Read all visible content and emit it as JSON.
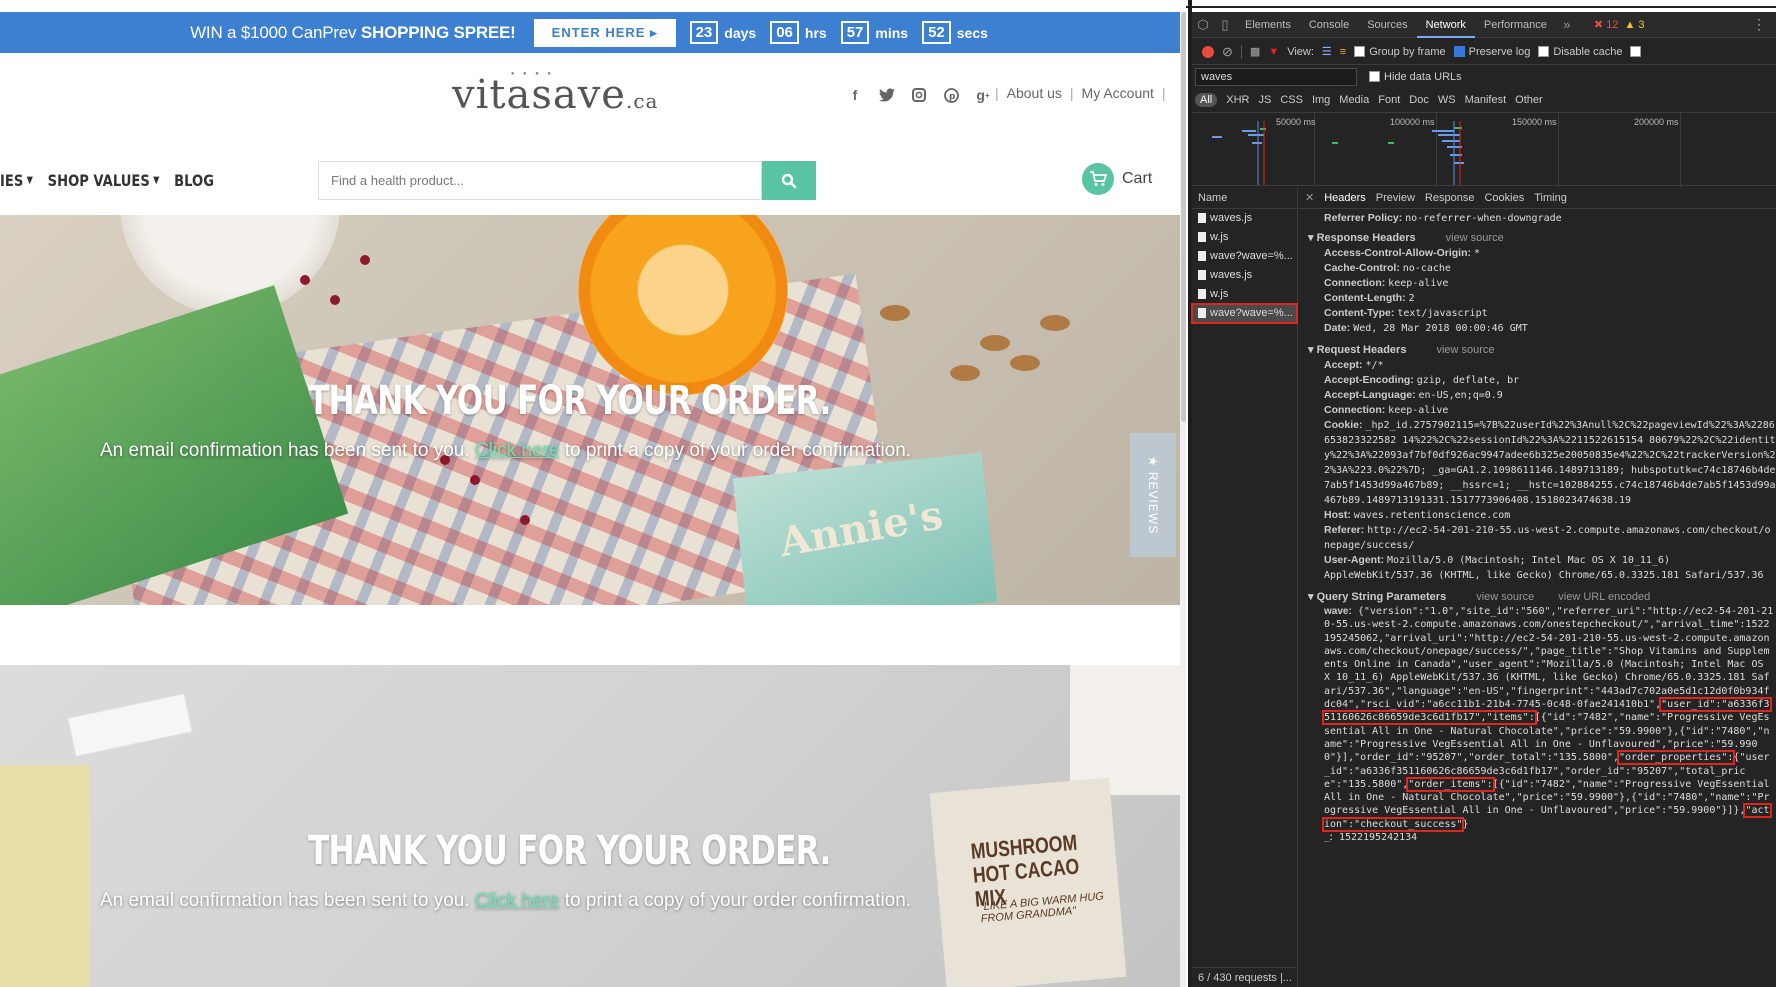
{
  "promo": {
    "text_win": "WIN a $1000 CanPrev ",
    "text_spree": "SHOPPING SPREE!",
    "button": "ENTER HERE",
    "days": "23",
    "days_label": "days",
    "hrs": "06",
    "hrs_label": "hrs",
    "mins": "57",
    "mins_label": "mins",
    "secs": "52",
    "secs_label": "secs",
    "bg_color": "#3d7fd0"
  },
  "header": {
    "logo_main": "vitasave",
    "logo_tld": ".ca",
    "about": "About us",
    "account": "My Account",
    "social_icons": [
      "facebook-icon",
      "twitter-icon",
      "instagram-icon",
      "pinterest-icon",
      "google-plus-icon"
    ]
  },
  "nav": {
    "items": [
      {
        "label": "IES"
      },
      {
        "label": "SHOP VALUES"
      },
      {
        "label": "BLOG"
      }
    ]
  },
  "search": {
    "placeholder": "Find a health product..."
  },
  "cart": {
    "label": "Cart"
  },
  "hero": {
    "thanks": "THANK YOU FOR YOUR ORDER.",
    "email_pre": "An email confirmation has been sent to you. ",
    "link": "Click here",
    "email_post": " to print a copy of your order confirmation.",
    "box_brand": "Annie's",
    "cocoa_name": "MUSHROOM HOT CACAO MIX",
    "cocoa_quote": "\"LIKE A BIG WARM HUG FROM GRANDMA\""
  },
  "reviews_tab": "★ REVIEWS",
  "devtools": {
    "tabs": [
      "Elements",
      "Console",
      "Sources",
      "Network",
      "Performance"
    ],
    "active_tab": "Network",
    "errors": "12",
    "warnings": "3",
    "view_label": "View:",
    "group_by_frame": "Group by frame",
    "preserve_log": "Preserve log",
    "disable_cache": "Disable cache",
    "filter_value": "waves",
    "hide_data_urls": "Hide data URLs",
    "types": [
      "All",
      "XHR",
      "JS",
      "CSS",
      "Img",
      "Media",
      "Font",
      "Doc",
      "WS",
      "Manifest",
      "Other"
    ],
    "timeline_labels": [
      "50000 ms",
      "100000 ms",
      "150000 ms",
      "200000 ms"
    ],
    "name_header": "Name",
    "requests": [
      "waves.js",
      "w.js",
      "wave?wave=%...",
      "waves.js",
      "w.js",
      "wave?wave=%..."
    ],
    "requests_footer": "6 / 430 requests  |...",
    "detail_tabs": [
      "Headers",
      "Preview",
      "Response",
      "Cookies",
      "Timing"
    ],
    "referrer_policy_key": "Referrer Policy:",
    "referrer_policy_val": "no-referrer-when-downgrade",
    "response_headers_title": "Response Headers",
    "view_source": "view source",
    "view_url_encoded": "view URL encoded",
    "response_headers": [
      {
        "k": "Access-Control-Allow-Origin:",
        "v": "*"
      },
      {
        "k": "Cache-Control:",
        "v": "no-cache"
      },
      {
        "k": "Connection:",
        "v": "keep-alive"
      },
      {
        "k": "Content-Length:",
        "v": "2"
      },
      {
        "k": "Content-Type:",
        "v": "text/javascript"
      },
      {
        "k": "Date:",
        "v": "Wed, 28 Mar 2018 00:00:46 GMT"
      }
    ],
    "request_headers_title": "Request Headers",
    "request_headers": [
      {
        "k": "Accept:",
        "v": "*/*"
      },
      {
        "k": "Accept-Encoding:",
        "v": "gzip, deflate, br"
      },
      {
        "k": "Accept-Language:",
        "v": "en-US,en;q=0.9"
      },
      {
        "k": "Connection:",
        "v": "keep-alive"
      }
    ],
    "cookie_key": "Cookie:",
    "cookie_val": "_hp2_id.2757902115=%7B%22userId%22%3Anull%2C%22pageviewId%22%3A%2286653823322582 14%22%2C%22sessionId%22%3A%2211522615154 80679%22%2C%22identity%22%3A%22093af7bf0df926ac9947adee6b325e20050835e4%22%2C%22trackerVersion%22%3A%223.0%22%7D; _ga=GA1.2.1098611146.1489713189; hubspotutk=c74c18746b4de7ab5f1453d99a467b89; __hssrc=1; __hstc=102884255.c74c18746b4de7ab5f1453d99a467b89.1489713191331.1517773906408.1518023474638.19",
    "host_key": "Host:",
    "host_val": "waves.retentionscience.com",
    "referer_key": "Referer:",
    "referer_val": "http://ec2-54-201-210-55.us-west-2.compute.amazonaws.com/checkout/onepage/success/",
    "ua_key": "User-Agent:",
    "ua_val": "Mozilla/5.0 (Macintosh; Intel Mac OS X 10_11_6) AppleWebKit/537.36 (KHTML, like Gecko) Chrome/65.0.3325.181 Safari/537.36",
    "qs_title": "Query String Parameters",
    "qs_wave_key": "wave:",
    "qs_part1": "{\"version\":\"1.0\",\"site_id\":\"560\",\"referrer_uri\":\"http://ec2-54-201-210-55.us-west-2.compute.amazonaws.com/onestepcheckout/\",\"arrival_time\":1522195245062,\"arrival_uri\":\"http://ec2-54-201-210-55.us-west-2.compute.amazonaws.com/checkout/onepage/success/\",\"page_title\":\"Shop Vitamins and Supplements Online in Canada\",\"user_agent\":\"Mozilla/5.0 (Macintosh; Intel Mac OS X 10_11_6) AppleWebKit/537.36 (KHTML, like Gecko) Chrome/65.0.3325.181 Safari/537.36\",\"language\":\"en-US\",\"fingerprint\":\"443ad7c702a0e5d1c12d0f0b934fdc04\",\"rsci_vid\":\"a6cc11b1-21b4-7745-0c48-0fae241410b1\",",
    "qs_user_id": "\"user_id\":\"a6336f351160626c86659de3c6d1fb17\",\"items\":",
    "qs_part2": "[{\"id\":\"7482\",\"name\":\"Progressive VegEssential All in One - Natural Chocolate\",\"price\":\"59.9900\"},{\"id\":\"7480\",\"name\":\"Progressive VegEssential All in One - Unflavoured\",\"price\":\"59.9900\"}],\"order_id\":\"95207\",\"order_total\":\"135.5800\",",
    "qs_order_props": "\"order_properties\":",
    "qs_part3": "{\"user_id\":\"a6336f351160626c86659de3c6d1fb17\",\"order_id\":\"95207\",\"total_price\":\"135.5800\",",
    "qs_order_items": "\"order_items\":",
    "qs_part4": "[{\"id\":\"7482\",\"name\":\"Progressive VegEssential All in One - Natural Chocolate\",\"price\":\"59.9900\"},{\"id\":\"7480\",\"name\":\"Progressive VegEssential All in One - Unflavoured\",\"price\":\"59.9900\"}]},",
    "qs_action": "\"action\":\"checkout_success\"",
    "qs_part5": "}",
    "qs_underscore": "_:",
    "qs_underscore_val": "1522195242134"
  }
}
